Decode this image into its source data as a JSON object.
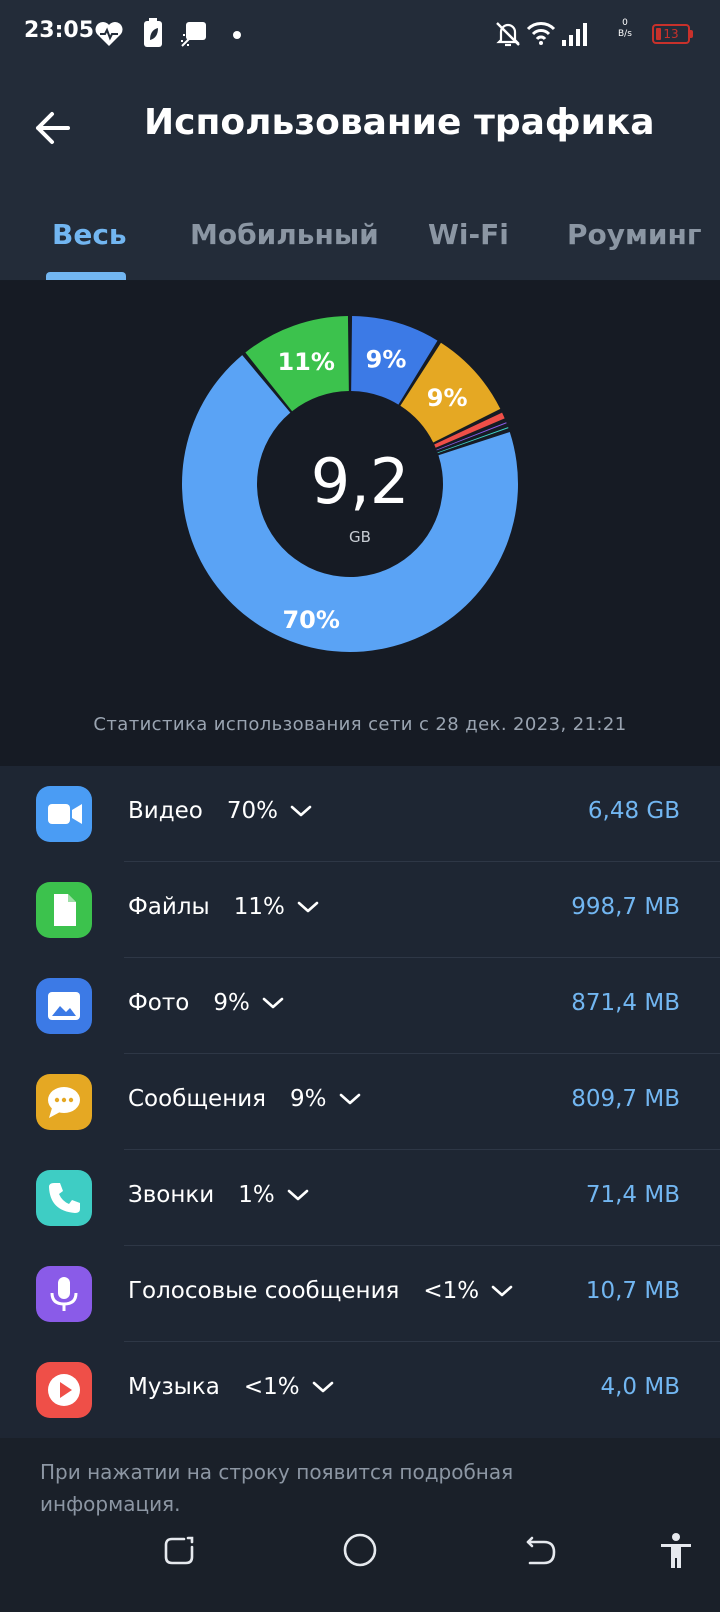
{
  "status_bar": {
    "time": "23:05",
    "net_speed_value": "0",
    "net_speed_unit": "B/s",
    "battery_level": "13",
    "icons": [
      "heart-icon",
      "battery-saver-icon",
      "app-notification-icon",
      "dot-icon",
      "bell-off-icon",
      "wifi-icon",
      "signal-icon"
    ]
  },
  "header": {
    "title": "Использование трафика",
    "back_icon": "arrow-left-icon"
  },
  "tabs": [
    {
      "label": "Весь",
      "active": true
    },
    {
      "label": "Мобильный",
      "active": false
    },
    {
      "label": "Wi-Fi",
      "active": false
    },
    {
      "label": "Роуминг",
      "active": false
    }
  ],
  "summary": {
    "total_value": "9,2",
    "total_unit": "GB",
    "caption": "Статистика использования сети с 28 дек. 2023, 21:21"
  },
  "chart_data": {
    "type": "pie",
    "center_label": "9,2 GB",
    "categories": [
      "Видео",
      "Файлы",
      "Фото",
      "Сообщения",
      "Звонки",
      "Голосовые сообщения",
      "Музыка"
    ],
    "values": [
      70,
      11,
      9,
      9,
      1,
      0.5,
      0.5
    ],
    "slice_labels": [
      "70%",
      "11%",
      "9%",
      "9%",
      "",
      "",
      ""
    ],
    "colors": [
      "#5aa3f5",
      "#3cc24d",
      "#3c7ae6",
      "#e5a823",
      "#ef4f48",
      "#8a5be8",
      "#3ed0c6"
    ]
  },
  "items": [
    {
      "name": "Видео",
      "percent": "70%",
      "value": "6,48 GB",
      "icon": "video-camera-icon",
      "color": "#4a9cf4"
    },
    {
      "name": "Файлы",
      "percent": "11%",
      "value": "998,7 MB",
      "icon": "file-icon",
      "color": "#3cc24d"
    },
    {
      "name": "Фото",
      "percent": "9%",
      "value": "871,4 MB",
      "icon": "image-icon",
      "color": "#3c7ae6"
    },
    {
      "name": "Сообщения",
      "percent": "9%",
      "value": "809,7 MB",
      "icon": "chat-bubble-icon",
      "color": "#e5a823"
    },
    {
      "name": "Звонки",
      "percent": "1%",
      "value": "71,4 MB",
      "icon": "phone-icon",
      "color": "#3ecdc4"
    },
    {
      "name": "Голосовые сообщения",
      "percent": "<1%",
      "value": "10,7 MB",
      "icon": "microphone-icon",
      "color": "#8a5be8"
    },
    {
      "name": "Музыка",
      "percent": "<1%",
      "value": "4,0 MB",
      "icon": "play-icon",
      "color": "#ef4f48"
    }
  ],
  "footer": {
    "hint": "При нажатии на строку появится подробная информация."
  },
  "nav_bar": {
    "icons": [
      "recent-apps-icon",
      "home-icon",
      "back-icon",
      "accessibility-icon"
    ]
  }
}
